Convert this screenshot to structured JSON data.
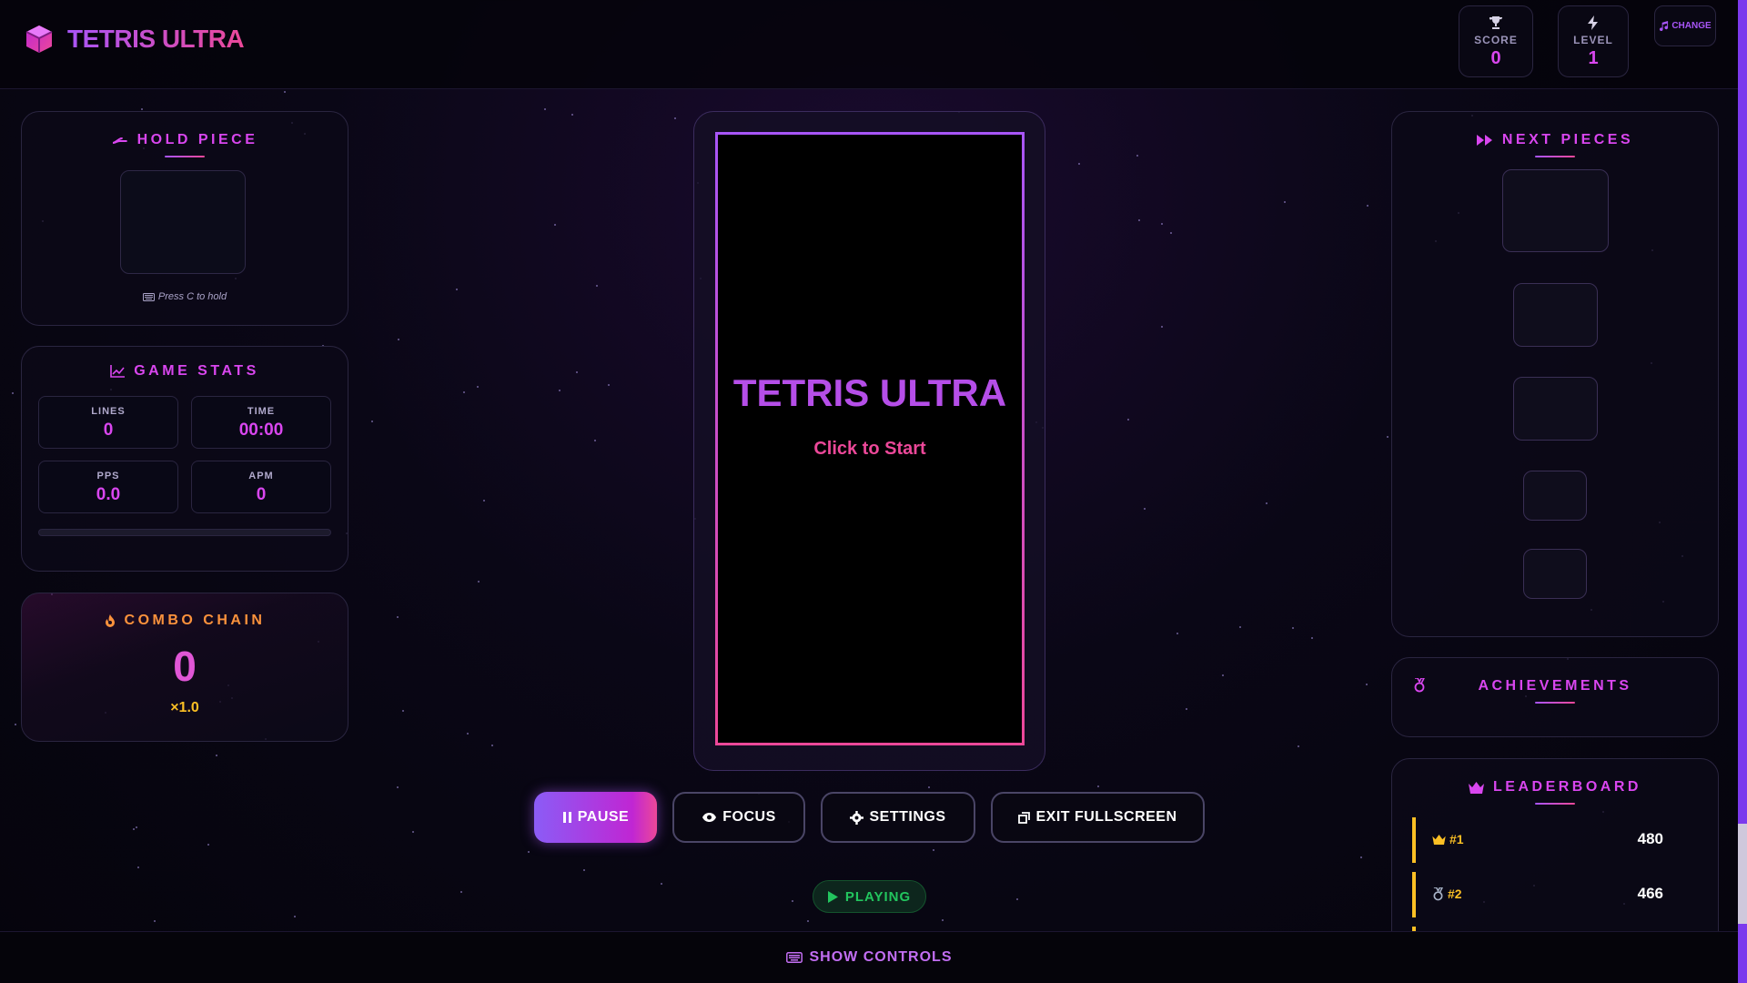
{
  "app": {
    "title": "TETRIS ULTRA"
  },
  "header": {
    "score": {
      "label": "SCORE",
      "value": "0"
    },
    "level": {
      "label": "LEVEL",
      "value": "1"
    },
    "music_label": "CHANGE"
  },
  "hold": {
    "title": "HOLD PIECE",
    "hint": "Press C to hold"
  },
  "stats": {
    "title": "GAME STATS",
    "lines": {
      "label": "LINES",
      "value": "0"
    },
    "time": {
      "label": "TIME",
      "value": "00:00"
    },
    "pps": {
      "label": "PPS",
      "value": "0.0"
    },
    "apm": {
      "label": "APM",
      "value": "0"
    },
    "progress": 0
  },
  "combo": {
    "title": "COMBO CHAIN",
    "value": "0",
    "multiplier": "×1.0"
  },
  "board": {
    "title": "TETRIS ULTRA",
    "subtitle": "Click to Start"
  },
  "controls": {
    "pause": "PAUSE",
    "focus": "FOCUS",
    "settings": "SETTINGS",
    "exit_fullscreen": "EXIT FULLSCREEN"
  },
  "status": {
    "label": "PLAYING",
    "color": "#22c55e"
  },
  "next": {
    "title": "NEXT PIECES"
  },
  "achievements": {
    "title": "ACHIEVEMENTS"
  },
  "leaderboard": {
    "title": "LEADERBOARD",
    "entries": [
      {
        "rank": "#1",
        "score": "480"
      },
      {
        "rank": "#2",
        "score": "466"
      }
    ]
  },
  "footer": {
    "show_controls": "SHOW CONTROLS"
  },
  "colors": {
    "accent": "#a855f7",
    "accent2": "#ec4899",
    "gold": "#fbbf24",
    "success": "#22c55e"
  }
}
